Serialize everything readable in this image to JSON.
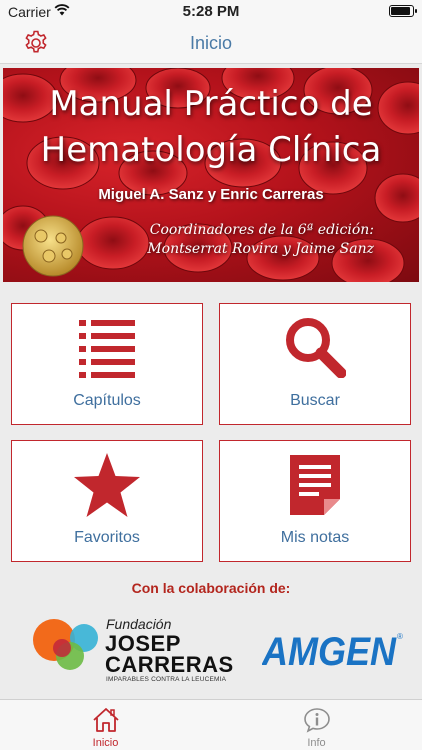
{
  "status_bar": {
    "carrier": "Carrier",
    "time": "5:28 PM",
    "battery_level": 0.8
  },
  "nav": {
    "title": "Inicio",
    "settings_icon": "gear-icon"
  },
  "hero": {
    "title_line1": "Manual Práctico de",
    "title_line2": "Hematología Clínica",
    "authors": "Miguel A. Sanz y Enric Carreras",
    "coord_line1": "Coordinadores de la 6ª edición:",
    "coord_line2": "Montserrat Rovira y Jaime Sanz"
  },
  "menu": {
    "capitulos": {
      "label": "Capítulos",
      "icon": "list-icon"
    },
    "buscar": {
      "label": "Buscar",
      "icon": "magnifier-icon"
    },
    "favoritos": {
      "label": "Favoritos",
      "icon": "star-icon"
    },
    "notas": {
      "label": "Mis notas",
      "icon": "notes-icon"
    }
  },
  "collaboration": {
    "heading": "Con la colaboración de:",
    "fundacion": {
      "line1": "Fundación",
      "line2": "JOSEP",
      "line3": "CARRERAS",
      "tagline": "IMPARABLES CONTRA LA LEUCEMIA"
    },
    "amgen": {
      "name": "AMGEN"
    }
  },
  "tab_bar": {
    "tabs": [
      {
        "label": "Inicio",
        "icon": "home-icon",
        "selected": true
      },
      {
        "label": "Info",
        "icon": "info-icon",
        "selected": false
      }
    ]
  },
  "colors": {
    "accent": "#c1272d",
    "label_blue": "#3f6f9e",
    "nav_title": "#4a7aa6",
    "amgen_blue": "#1a73c4"
  }
}
